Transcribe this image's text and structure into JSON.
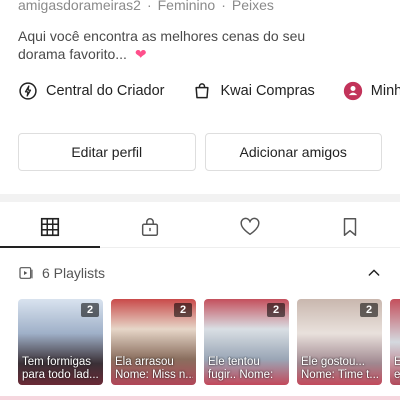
{
  "profile": {
    "username": "amigasdorameiras2",
    "gender": "Feminino",
    "sign": "Peixes",
    "separator": "·",
    "bio": "Aqui você encontra as melhores cenas do seu dorama favorito... ",
    "bio_emoji": "❤"
  },
  "links": [
    {
      "label": "Central do Criador",
      "icon": "lightning-icon"
    },
    {
      "label": "Kwai Compras",
      "icon": "shopping-bag-icon"
    },
    {
      "label": "Minha",
      "icon": "avatar-icon"
    }
  ],
  "actions": {
    "edit_profile": "Editar perfil",
    "add_friends": "Adicionar amigos"
  },
  "tabs": [
    {
      "icon": "grid-icon",
      "active": true
    },
    {
      "icon": "lock-icon",
      "active": false
    },
    {
      "icon": "heart-icon",
      "active": false
    },
    {
      "icon": "bookmark-icon",
      "active": false
    }
  ],
  "playlists": {
    "title": "6 Playlists",
    "items": [
      {
        "count": "2",
        "line1": "Tem formigas",
        "line2": "para todo lad..."
      },
      {
        "count": "2",
        "line1": "Ela arrasou",
        "line2": "Nome: Miss n..."
      },
      {
        "count": "2",
        "line1": "Ele tentou",
        "line2": "fugir.. Nome:"
      },
      {
        "count": "2",
        "line1": "Ele gostou...",
        "line2": "Nome: Time t..."
      },
      {
        "count": "",
        "line1": "E",
        "line2": "e m"
      }
    ]
  },
  "colors": {
    "accent_pink": "#ff4f8b",
    "avatar_red": "#c2335a",
    "text_primary": "#222222",
    "text_muted": "#8a8a8a"
  }
}
